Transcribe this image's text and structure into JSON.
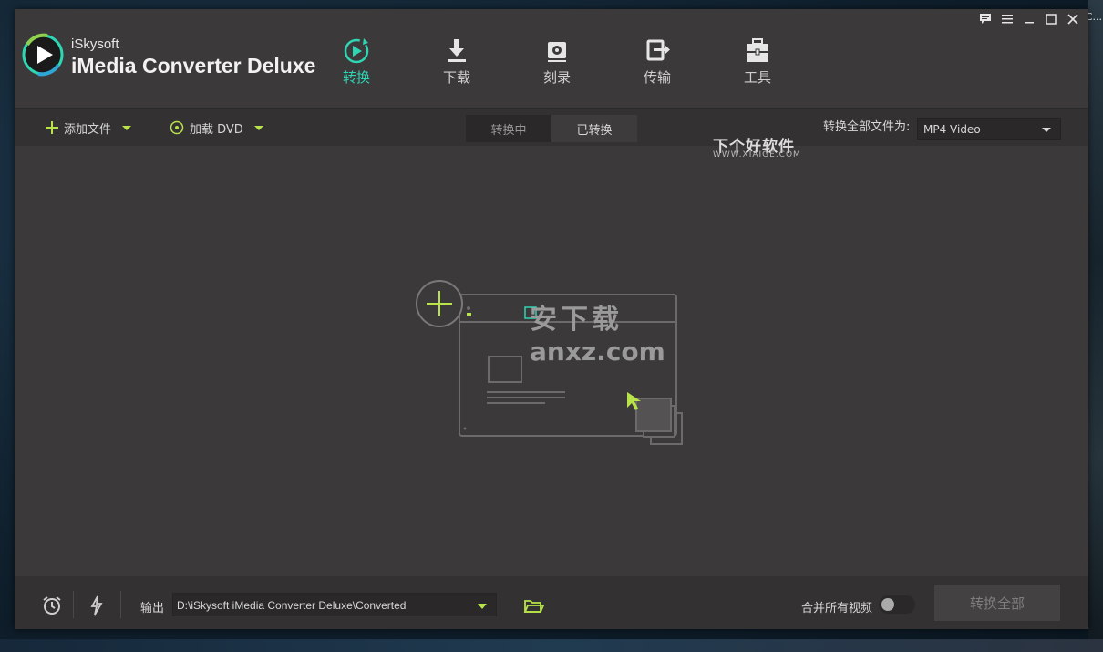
{
  "app": {
    "brand_small": "iSkysoft",
    "brand_name": "iMedia Converter Deluxe"
  },
  "nav": {
    "tabs": [
      {
        "label": "转换",
        "icon": "convert-icon",
        "active": true
      },
      {
        "label": "下载",
        "icon": "download-icon",
        "active": false
      },
      {
        "label": "刻录",
        "icon": "burn-icon",
        "active": false
      },
      {
        "label": "传输",
        "icon": "transfer-icon",
        "active": false
      },
      {
        "label": "工具",
        "icon": "toolbox-icon",
        "active": false
      }
    ]
  },
  "toolbar": {
    "add_files": "添加文件",
    "load_dvd": "加载 DVD",
    "seg_converting": "转换中",
    "seg_converted": "已转换",
    "convert_all_to_label": "转换全部文件为:",
    "format_value": "MP4 Video"
  },
  "watermark": {
    "site_cn": "下个好软件",
    "site_url": "WWW.XIAIGE.COM",
    "anxz_cn": "安下载",
    "anxz_url": "anxz.com"
  },
  "bottombar": {
    "output_label": "输出",
    "output_path": "D:\\iSkysoft iMedia Converter Deluxe\\Converted",
    "merge_label": "合并所有视频",
    "merge_on": false,
    "convert_all_button": "转换全部"
  },
  "desktop": {
    "right_edge_text": "C..."
  },
  "colors": {
    "accent": "#2fd6b4",
    "green": "#b8e34a",
    "window_bg": "#3b393a",
    "bar_bg": "#333132"
  }
}
